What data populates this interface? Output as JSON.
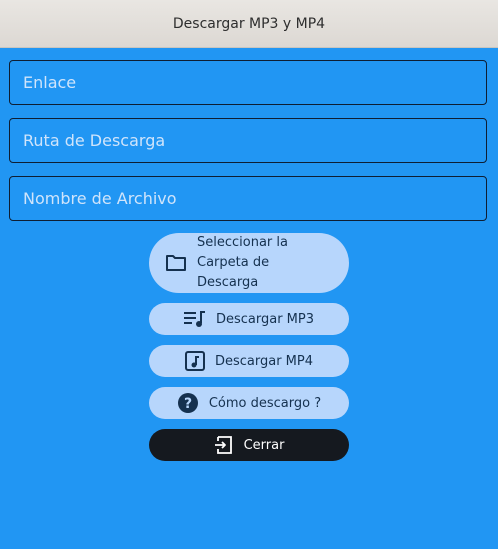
{
  "window": {
    "title": "Descargar MP3 y MP4"
  },
  "form": {
    "link_placeholder": "Enlace",
    "path_placeholder": "Ruta de Descarga",
    "filename_placeholder": "Nombre de Archivo"
  },
  "buttons": {
    "select_folder": "Seleccionar la Carpeta de Descarga",
    "download_mp3": "Descargar MP3",
    "download_mp4": "Descargar MP4",
    "help": "Cómo descargo ?",
    "close": "Cerrar"
  },
  "icons": {
    "select_folder": "folder-icon",
    "download_mp3": "playlist-music-icon",
    "download_mp4": "music-note-box-icon",
    "help": "help-circle-icon",
    "close": "exit-icon"
  },
  "colors": {
    "background": "#2196f3",
    "button": "#b7d6fc",
    "close_button": "#15191f"
  }
}
